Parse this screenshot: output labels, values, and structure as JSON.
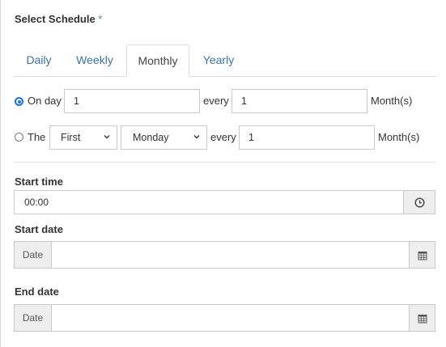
{
  "heading": {
    "label": "Select Schedule",
    "required_mark": "*"
  },
  "tabs": [
    {
      "label": "Daily",
      "active": false
    },
    {
      "label": "Weekly",
      "active": false
    },
    {
      "label": "Monthly",
      "active": true
    },
    {
      "label": "Yearly",
      "active": false
    }
  ],
  "monthly": {
    "option_day": {
      "label": "On day",
      "checked": true,
      "day_value": "1",
      "every_label": "every",
      "months_value": "1",
      "unit_label": "Month(s)"
    },
    "option_the": {
      "label": "The",
      "checked": false,
      "ordinal_selected": "First",
      "weekday_selected": "Monday",
      "every_label": "every",
      "months_value": "1",
      "unit_label": "Month(s)"
    }
  },
  "start_time": {
    "label": "Start time",
    "value": "00:00",
    "icon": "clock-icon"
  },
  "start_date": {
    "label": "Start date",
    "addon": "Date",
    "value": "",
    "icon": "calendar-icon"
  },
  "end_date": {
    "label": "End date",
    "addon": "Date",
    "value": "",
    "icon": "calendar-icon"
  },
  "colors": {
    "accent": "#1a73e8",
    "tab_link": "#3b73a8",
    "addon_bg": "#eeeeee"
  }
}
